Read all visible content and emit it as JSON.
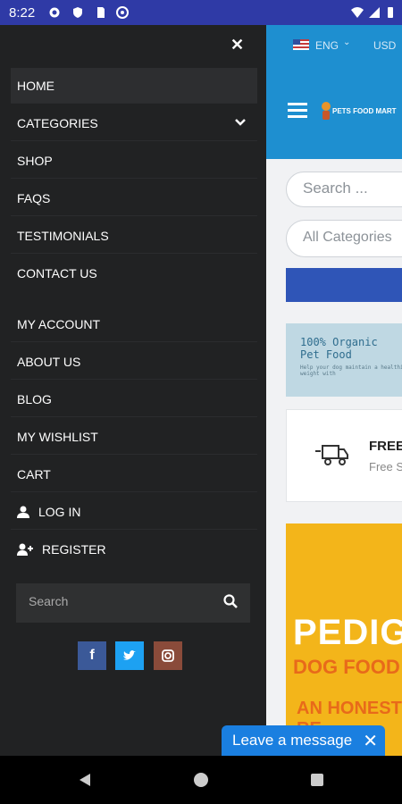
{
  "status_bar": {
    "time": "8:22"
  },
  "topbar": {
    "language": "ENG",
    "currency": "USD"
  },
  "header": {
    "logo_text": "PETS FOOD MART"
  },
  "search": {
    "placeholder": "Search ..."
  },
  "categories_select": {
    "value": "All Categories"
  },
  "promo_banner": {
    "line1": "100% Organic",
    "line2": "Pet Food",
    "tagline": "Help your dog maintain a healthier weight with"
  },
  "shipping_box": {
    "title": "FREE",
    "subtitle": "Free S"
  },
  "pedigree_banner": {
    "brand": "PEDIGRE",
    "subtitle": "DOG FOOD",
    "tagline": "AN HONEST RE"
  },
  "drawer": {
    "menu": [
      {
        "label": "HOME"
      },
      {
        "label": "CATEGORIES"
      },
      {
        "label": "SHOP"
      },
      {
        "label": "FAQS"
      },
      {
        "label": "TESTIMONIALS"
      },
      {
        "label": "CONTACT US"
      },
      {
        "label": "MY ACCOUNT"
      },
      {
        "label": "ABOUT US"
      },
      {
        "label": "BLOG"
      },
      {
        "label": "MY WISHLIST"
      },
      {
        "label": "CART"
      },
      {
        "label": "LOG IN"
      },
      {
        "label": "REGISTER"
      }
    ],
    "search_placeholder": "Search",
    "social": [
      {
        "icon": "facebook-icon",
        "glyph": "f"
      },
      {
        "icon": "twitter-icon",
        "glyph": "t"
      },
      {
        "icon": "instagram-icon",
        "glyph": "◎"
      }
    ]
  },
  "chat": {
    "label": "Leave a message"
  },
  "colors": {
    "drawer_bg": "#212223",
    "status_bar": "#2f3aa6",
    "header_blue": "#1e8fd0",
    "chat_blue": "#1a7fe0"
  }
}
